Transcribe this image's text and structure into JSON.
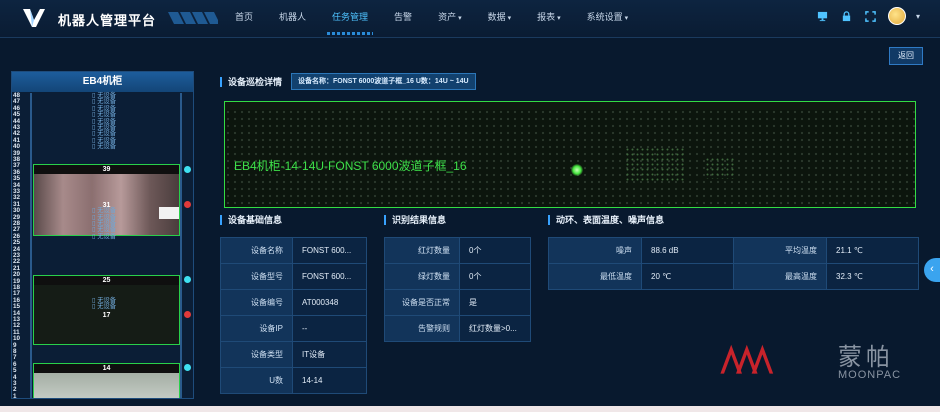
{
  "app": {
    "title": "机器人管理平台"
  },
  "nav": [
    {
      "label": "首页",
      "active": false,
      "caret": false
    },
    {
      "label": "机器人",
      "active": false,
      "caret": false
    },
    {
      "label": "任务管理",
      "active": true,
      "caret": false
    },
    {
      "label": "告警",
      "active": false,
      "caret": false
    },
    {
      "label": "资产",
      "active": false,
      "caret": false
    },
    {
      "label": "数据",
      "active": false,
      "caret": false
    },
    {
      "label": "报表",
      "active": false,
      "caret": false
    },
    {
      "label": "系统设置",
      "active": false,
      "caret": false
    }
  ],
  "header_icons": [
    "monitor-icon",
    "lock-icon",
    "fullscreen-icon"
  ],
  "back_button": "返回",
  "rack": {
    "title": "EB4机柜",
    "empty_label": "无设备",
    "devices": [
      {
        "top_label": "39",
        "mid_label": "31"
      },
      {
        "top_label": "25",
        "mid_label": "17"
      },
      {
        "top_label": "14",
        "mid_label": ""
      }
    ]
  },
  "inspection": {
    "title": "设备巡检详情",
    "device_tag": "设备名称：FONST 6000波道子框_16   U数：14U ~ 14U",
    "image_label": "EB4机柜-14-14U-FONST 6000波道子框_16"
  },
  "basic_info": {
    "title": "设备基础信息",
    "rows": [
      {
        "key": "设备名称",
        "value": "FONST 600..."
      },
      {
        "key": "设备型号",
        "value": "FONST 600..."
      },
      {
        "key": "设备编号",
        "value": "AT000348"
      },
      {
        "key": "设备IP",
        "value": "--"
      },
      {
        "key": "设备类型",
        "value": "IT设备"
      },
      {
        "key": "U数",
        "value": "14-14"
      }
    ]
  },
  "recognition": {
    "title": "识别结果信息",
    "rows": [
      {
        "key": "红灯数量",
        "value": "0个"
      },
      {
        "key": "绿灯数量",
        "value": "0个"
      },
      {
        "key": "设备是否正常",
        "value": "是"
      },
      {
        "key": "告警规则",
        "value": "红灯数量>0..."
      }
    ]
  },
  "environment": {
    "title": "动环、表面温度、噪声信息",
    "rows": [
      [
        {
          "key": "噪声",
          "value": "88.6 dB"
        },
        {
          "key": "平均温度",
          "value": "21.1 ℃"
        }
      ],
      [
        {
          "key": "最低温度",
          "value": "20 ℃"
        },
        {
          "key": "最高温度",
          "value": "32.3 ℃"
        }
      ]
    ]
  },
  "watermark": {
    "cn": "蒙帕",
    "en": "MOONPAC"
  },
  "colors": {
    "accent": "#38a2ff",
    "device_border": "#29d04a",
    "dot_cyan": "#3fe0f0",
    "dot_red": "#e23a3a"
  }
}
